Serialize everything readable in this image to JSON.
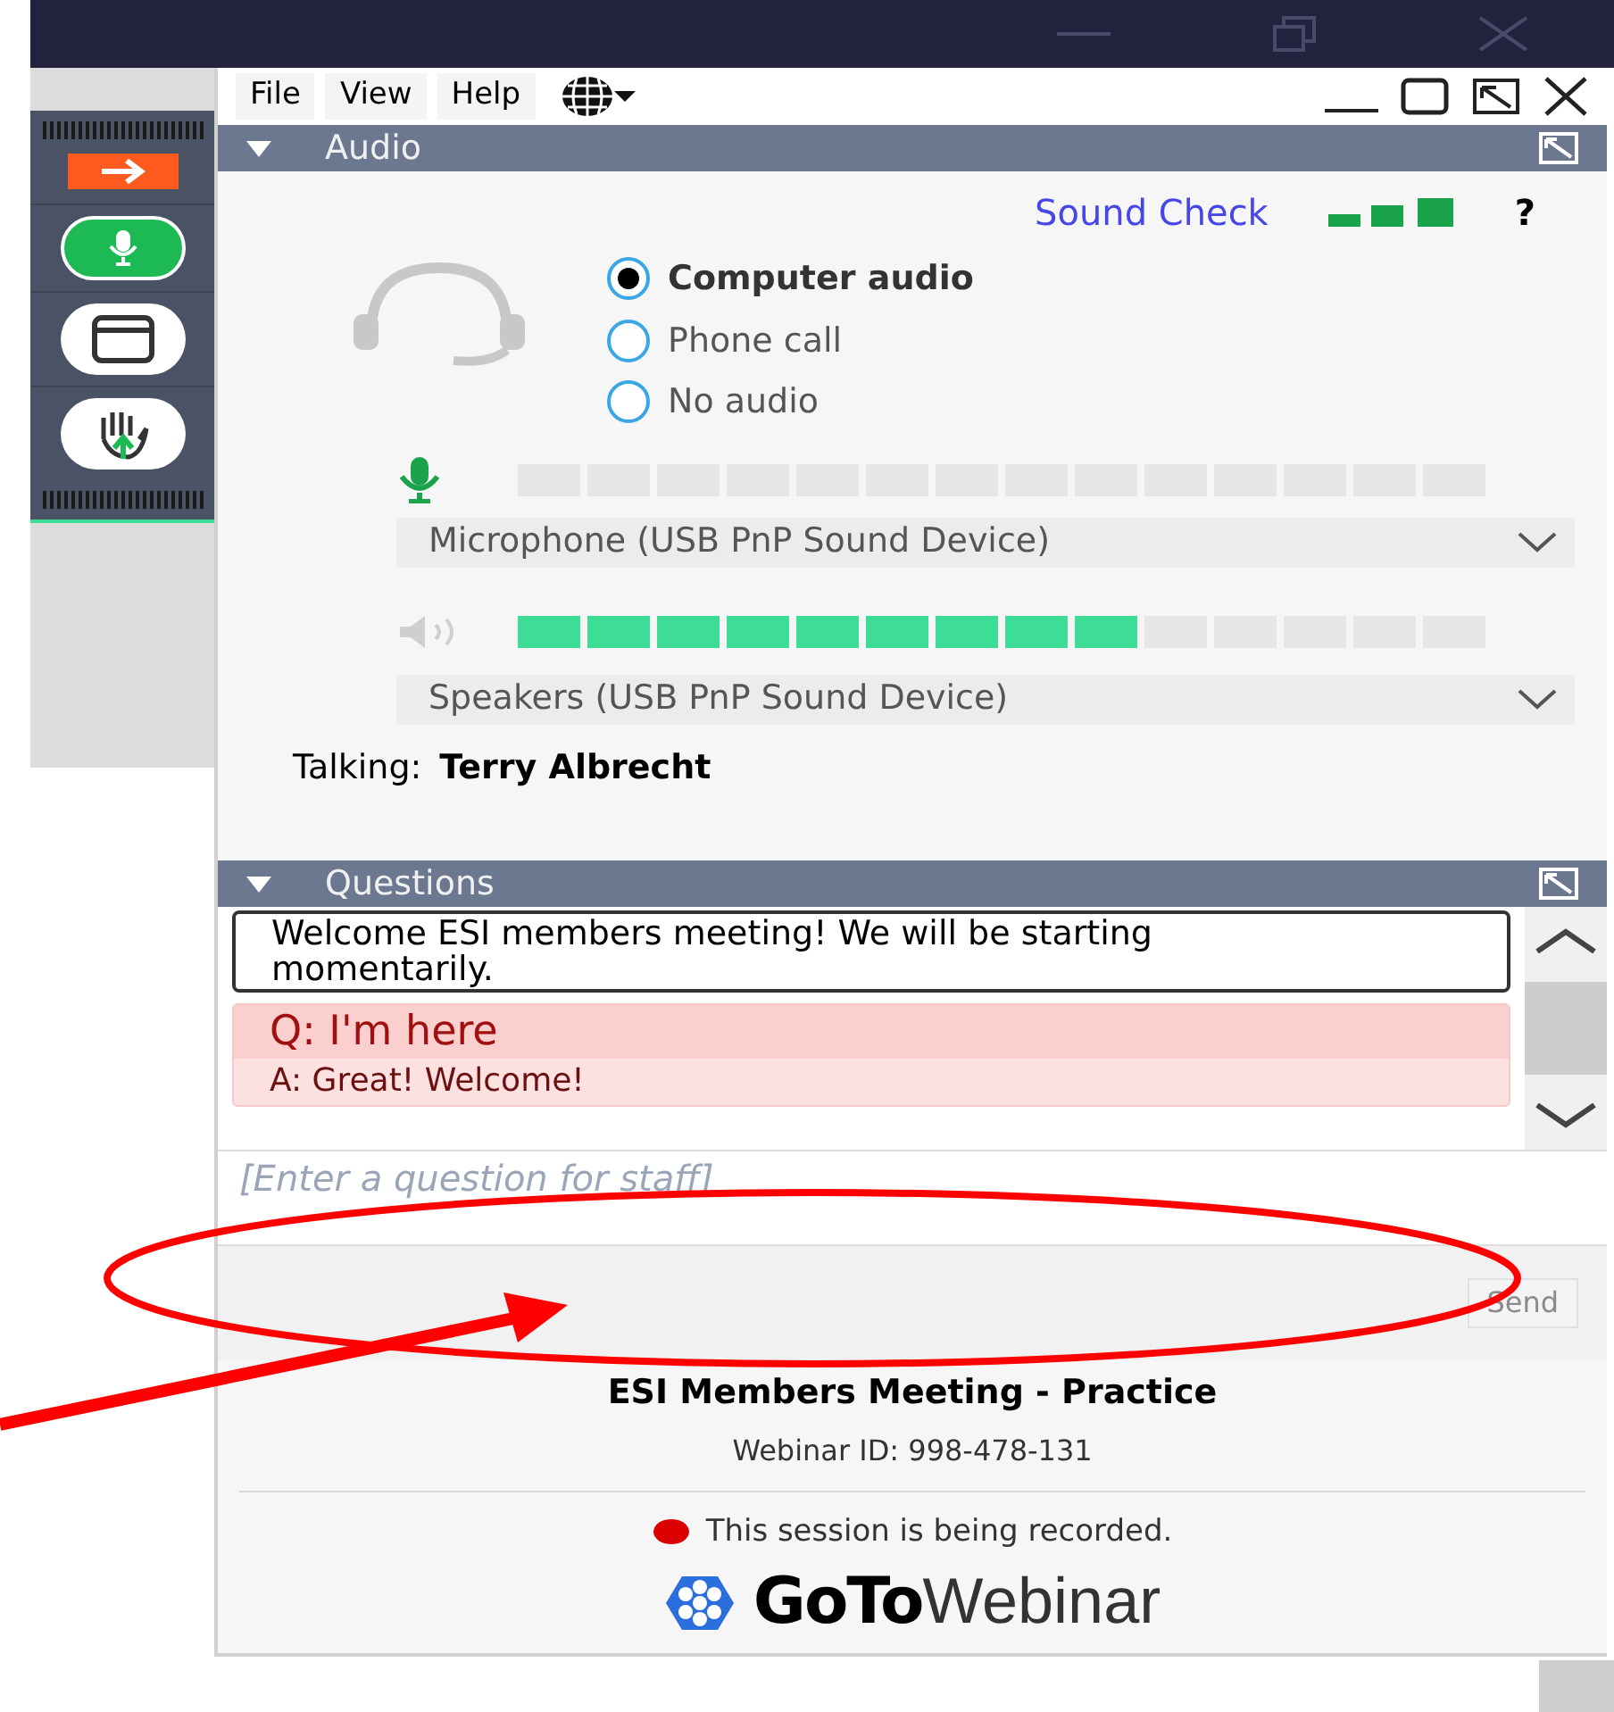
{
  "menu": [
    "File",
    "View",
    "Help"
  ],
  "audio": {
    "title": "Audio",
    "sound_check": "Sound Check",
    "help": "?",
    "options": [
      {
        "label": "Computer audio",
        "selected": true
      },
      {
        "label": "Phone call",
        "selected": false
      },
      {
        "label": "No audio",
        "selected": false
      }
    ],
    "microphone": {
      "level": 0,
      "device": "Microphone (USB PnP Sound Device)"
    },
    "speakers": {
      "level": 0.64,
      "device": "Speakers (USB PnP Sound Device)"
    },
    "talking_label": "Talking:",
    "talking_name": "Terry Albrecht"
  },
  "questions": {
    "title": "Questions",
    "messages": [
      {
        "kind": "announcement",
        "text": "Welcome ESI members meeting!  We will be starting momentarily."
      },
      {
        "kind": "qa",
        "question": "Q: I'm here",
        "answer": "A: Great! Welcome!"
      }
    ],
    "placeholder": "[Enter a question for staff]",
    "send": "Send",
    "send_disabled": true
  },
  "footer": {
    "title": "ESI Members Meeting - Practice",
    "webinar_id": "Webinar ID: 998-478-131",
    "recording": "This session is being recorded.",
    "logo_bold": "GoTo",
    "logo_light": "Webinar"
  }
}
